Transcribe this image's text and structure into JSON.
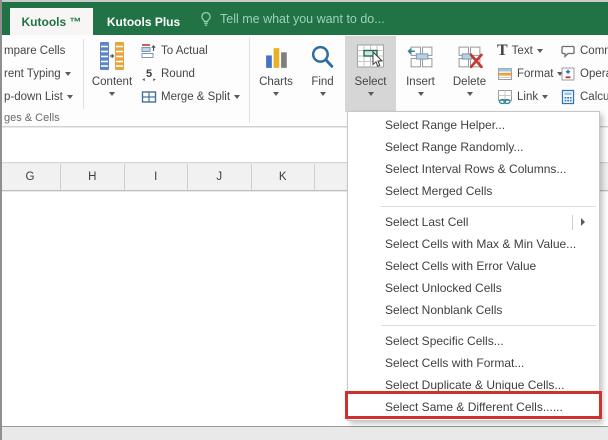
{
  "colors": {
    "accent_green": "#217346",
    "highlight_red": "#d0302e",
    "pressed_gray": "#d6d6d6"
  },
  "tab_bar": {
    "tabs": [
      {
        "label": "Kutools ™",
        "active": true
      },
      {
        "label": "Kutools Plus",
        "active": false
      }
    ],
    "tell_me": {
      "icon": "lightbulb-icon",
      "label": "Tell me what you want to do..."
    }
  },
  "ribbon": {
    "cut_left_buttons": [
      {
        "label": "mpare Cells",
        "dropdown": false
      },
      {
        "label": "rent Typing",
        "dropdown": true
      },
      {
        "label": "p-down List",
        "dropdown": true
      }
    ],
    "content_button": {
      "label": "Content",
      "icon": "content-columns-icon",
      "dropdown": true
    },
    "small_buttons": [
      {
        "label": "To Actual",
        "icon": "to-actual-icon",
        "dropdown": false
      },
      {
        "label": "Round",
        "icon": "round-5-icon",
        "dropdown": false
      },
      {
        "label": "Merge & Split",
        "icon": "merge-split-icon",
        "dropdown": true
      }
    ],
    "big_buttons": [
      {
        "label": "Charts",
        "icon": "charts-icon",
        "dropdown": true,
        "pressed": false
      },
      {
        "label": "Find",
        "icon": "find-icon",
        "dropdown": true,
        "pressed": false
      },
      {
        "label": "Select",
        "icon": "select-cells-icon",
        "dropdown": true,
        "pressed": true
      },
      {
        "label": "Insert",
        "icon": "insert-cells-icon",
        "dropdown": true,
        "pressed": false
      },
      {
        "label": "Delete",
        "icon": "delete-cells-icon",
        "dropdown": true,
        "pressed": false
      }
    ],
    "text_format_link": [
      {
        "label": "Text",
        "icon": "text-icon",
        "dropdown": true
      },
      {
        "label": "Format",
        "icon": "format-icon",
        "dropdown": true
      },
      {
        "label": "Link",
        "icon": "link-icon",
        "dropdown": true
      }
    ],
    "cut_right_buttons": [
      {
        "label": "Comm",
        "icon": "comment-icon"
      },
      {
        "label": "Opera",
        "icon": "operation-icon"
      },
      {
        "label": "Calcu",
        "icon": "calculation-icon"
      }
    ],
    "group_label": "ges & Cells"
  },
  "spreadsheet": {
    "column_headers": [
      "G",
      "H",
      "I",
      "J",
      "K"
    ]
  },
  "select_menu": {
    "items": [
      {
        "label": "Select Range Helper..."
      },
      {
        "label": "Select Range Randomly..."
      },
      {
        "label": "Select Interval Rows & Columns..."
      },
      {
        "label": "Select Merged Cells"
      },
      {
        "separator": true
      },
      {
        "label": "Select Last Cell",
        "submenu": true
      },
      {
        "label": "Select Cells with Max & Min Value..."
      },
      {
        "label": "Select Cells with Error Value"
      },
      {
        "label": "Select Unlocked Cells"
      },
      {
        "label": "Select Nonblank Cells"
      },
      {
        "separator": true
      },
      {
        "label": "Select Specific Cells..."
      },
      {
        "label": "Select Cells with Format..."
      },
      {
        "label": "Select Duplicate & Unique Cells..."
      },
      {
        "label": "Select Same & Different Cells......",
        "highlighted": true
      }
    ]
  }
}
